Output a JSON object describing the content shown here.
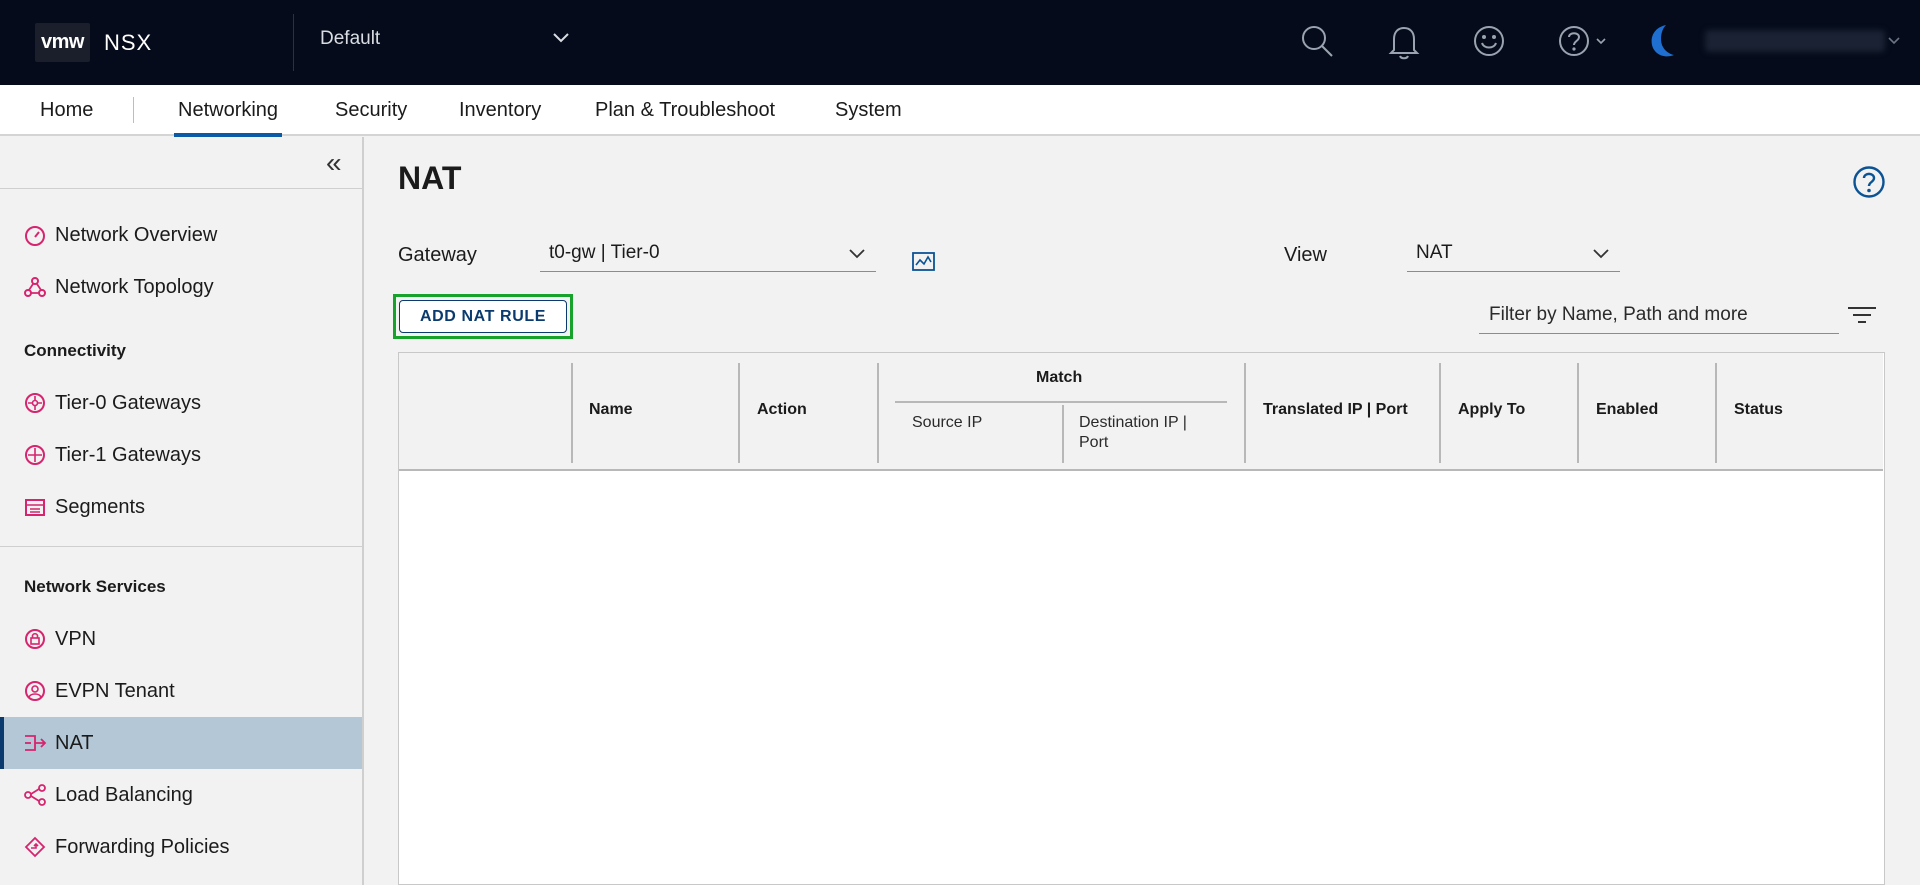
{
  "header": {
    "logo_text": "vmw",
    "app_name": "NSX",
    "project": "Default",
    "icons": [
      "search-icon",
      "bell-icon",
      "smiley-icon",
      "help-icon",
      "moon-icon"
    ]
  },
  "nav": {
    "home": "Home",
    "networking": "Networking",
    "security": "Security",
    "inventory": "Inventory",
    "plan": "Plan & Troubleshoot",
    "system": "System",
    "active": "Networking"
  },
  "sidebar": {
    "top": [
      {
        "label": "Network Overview",
        "icon": "dashboard-icon"
      },
      {
        "label": "Network Topology",
        "icon": "topology-icon"
      }
    ],
    "connectivity_heading": "Connectivity",
    "connectivity": [
      {
        "label": "Tier-0 Gateways",
        "icon": "gateway-icon"
      },
      {
        "label": "Tier-1 Gateways",
        "icon": "gateway-icon"
      },
      {
        "label": "Segments",
        "icon": "segments-icon"
      }
    ],
    "services_heading": "Network Services",
    "services": [
      {
        "label": "VPN",
        "icon": "vpn-icon"
      },
      {
        "label": "EVPN Tenant",
        "icon": "evpn-icon"
      },
      {
        "label": "NAT",
        "icon": "nat-icon",
        "selected": true
      },
      {
        "label": "Load Balancing",
        "icon": "load-balancing-icon"
      },
      {
        "label": "Forwarding Policies",
        "icon": "forwarding-icon"
      }
    ]
  },
  "main": {
    "title": "NAT",
    "gateway_label": "Gateway",
    "gateway_value": "t0-gw | Tier-0",
    "view_label": "View",
    "view_value": "NAT",
    "add_button": "ADD NAT RULE",
    "filter_placeholder": "Filter by Name, Path and more"
  },
  "table": {
    "headers": {
      "name": "Name",
      "action": "Action",
      "match": "Match",
      "source_ip": "Source IP",
      "destination": "Destination IP | Port",
      "translated": "Translated IP | Port",
      "apply_to": "Apply To",
      "enabled": "Enabled",
      "status": "Status"
    },
    "rows": []
  },
  "colors": {
    "header_bg": "#050b1a",
    "accent": "#0a5aa8",
    "icon_pink": "#d6246e",
    "selected_bg": "#b3c7d6",
    "highlight_green": "#17a22b"
  }
}
